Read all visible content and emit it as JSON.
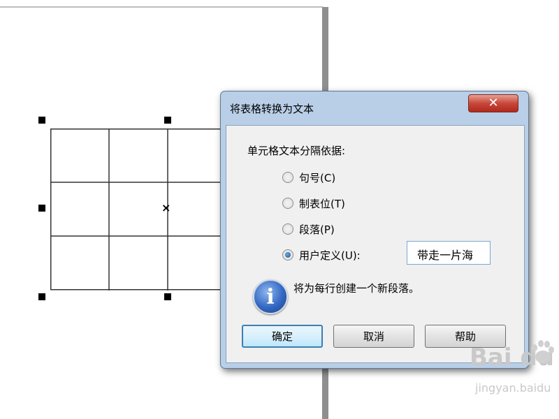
{
  "dialog": {
    "title": "将表格转换为文本",
    "group_label": "单元格文本分隔依据:",
    "options": [
      {
        "label": "句号(C)",
        "checked": false
      },
      {
        "label": "制表位(T)",
        "checked": false
      },
      {
        "label": "段落(P)",
        "checked": false
      },
      {
        "label": "用户定义(U):",
        "checked": true
      }
    ],
    "custom_value": "带走一片海",
    "info_text": "将为每行创建一个新段落。",
    "buttons": {
      "ok": "确定",
      "cancel": "取消",
      "help": "帮助"
    },
    "close_glyph": "✕",
    "info_glyph": "i"
  },
  "canvas": {
    "center_glyph": "×"
  },
  "watermark": {
    "logo": "Bai du",
    "sub": "jingyan.baidu"
  },
  "icons": [
    "close-icon",
    "info-icon",
    "paw-icon"
  ]
}
